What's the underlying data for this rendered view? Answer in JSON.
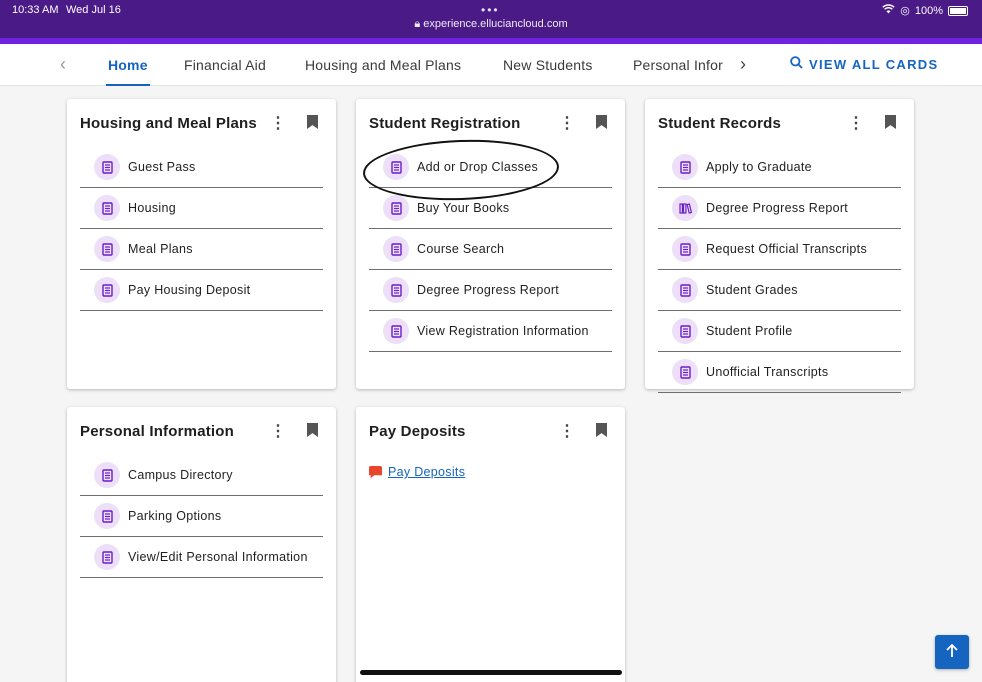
{
  "status_bar": {
    "time": "10:33 AM",
    "date": "Wed Jul 16",
    "url": "experience.elluciancloud.com",
    "battery": "100%"
  },
  "nav": {
    "tabs": [
      {
        "label": "Home",
        "active": true
      },
      {
        "label": "Financial Aid",
        "active": false
      },
      {
        "label": "Housing and Meal Plans",
        "active": false
      },
      {
        "label": "New Students",
        "active": false
      },
      {
        "label": "Personal Infor",
        "active": false
      }
    ],
    "view_all_label": "VIEW ALL CARDS"
  },
  "colors": {
    "brand_purple": "#4a1a86",
    "accent_blue": "#1565c0",
    "icon_bg": "#ecdff7",
    "icon_fg": "#6a1fc8"
  },
  "cards": {
    "housing": {
      "title": "Housing and Meal Plans",
      "items": [
        {
          "label": "Guest Pass",
          "icon": "book-icon"
        },
        {
          "label": "Housing",
          "icon": "book-icon"
        },
        {
          "label": "Meal Plans",
          "icon": "book-icon"
        },
        {
          "label": "Pay Housing Deposit",
          "icon": "book-icon"
        }
      ]
    },
    "registration": {
      "title": "Student Registration",
      "items": [
        {
          "label": "Add or Drop Classes",
          "icon": "book-icon"
        },
        {
          "label": "Buy Your Books",
          "icon": "book-icon"
        },
        {
          "label": "Course Search",
          "icon": "book-icon"
        },
        {
          "label": "Degree Progress Report",
          "icon": "book-icon"
        },
        {
          "label": "View Registration Information",
          "icon": "book-icon"
        }
      ]
    },
    "records": {
      "title": "Student Records",
      "items": [
        {
          "label": "Apply to Graduate",
          "icon": "book-icon"
        },
        {
          "label": "Degree Progress Report",
          "icon": "library-icon"
        },
        {
          "label": "Request Official Transcripts",
          "icon": "book-icon"
        },
        {
          "label": "Student Grades",
          "icon": "book-icon"
        },
        {
          "label": "Student Profile",
          "icon": "book-icon"
        },
        {
          "label": "Unofficial Transcripts",
          "icon": "book-icon"
        }
      ]
    },
    "personal": {
      "title": "Personal Information",
      "items": [
        {
          "label": "Campus Directory",
          "icon": "book-icon"
        },
        {
          "label": "Parking Options",
          "icon": "book-icon"
        },
        {
          "label": "View/Edit Personal Information",
          "icon": "book-icon"
        }
      ]
    },
    "deposits": {
      "title": "Pay Deposits",
      "link_label": "Pay Deposits"
    }
  }
}
